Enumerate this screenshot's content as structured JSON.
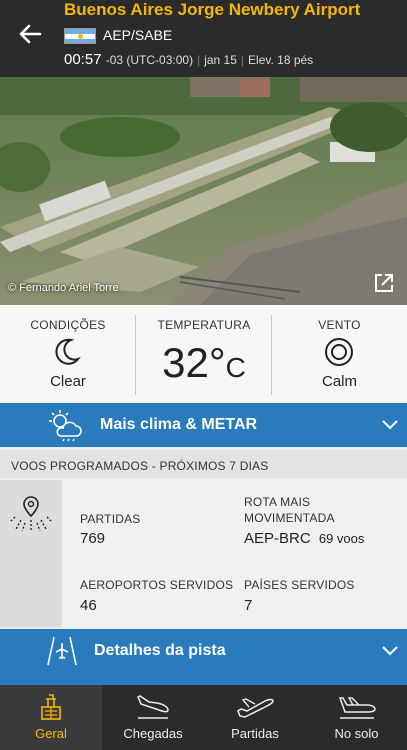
{
  "header": {
    "title": "Buenos Aires Jorge Newbery Airport",
    "codes": "AEP/SABE",
    "time": "00:57",
    "timezone": "-03 (UTC-03:00)",
    "date": "jan 15",
    "elevation": "Elev. 18 pés"
  },
  "photo": {
    "credit": "© Fernando Ariel Torre"
  },
  "conditions": {
    "label_conditions": "CONDIÇÕES",
    "label_temperature": "TEMPERATURA",
    "label_wind": "VENTO",
    "conditions_value": "Clear",
    "temperature_value": "32°",
    "temperature_unit": "C",
    "wind_value": "Calm"
  },
  "weather_bar": {
    "label": "Mais clima & METAR"
  },
  "scheduled": {
    "header": "VOOS PROGRAMADOS - PRÓXIMOS 7 DIAS",
    "departures_label": "PARTIDAS",
    "departures_value": "769",
    "busiest_route_label_1": "ROTA MAIS",
    "busiest_route_label_2": "MOVIMENTADA",
    "busiest_route_value": "AEP-BRC",
    "busiest_route_flights": "69 voos",
    "airports_served_label": "AEROPORTOS SERVIDOS",
    "airports_served_value": "46",
    "countries_served_label": "PAÍSES SERVIDOS",
    "countries_served_value": "7"
  },
  "runway_bar": {
    "label": "Detalhes da pista"
  },
  "nav": {
    "items": [
      {
        "label": "Geral"
      },
      {
        "label": "Chegadas"
      },
      {
        "label": "Partidas"
      },
      {
        "label": "No solo"
      }
    ]
  },
  "colors": {
    "accent": "#f5b800",
    "blue": "#2a7bbd",
    "dark": "#2b2b2b"
  }
}
